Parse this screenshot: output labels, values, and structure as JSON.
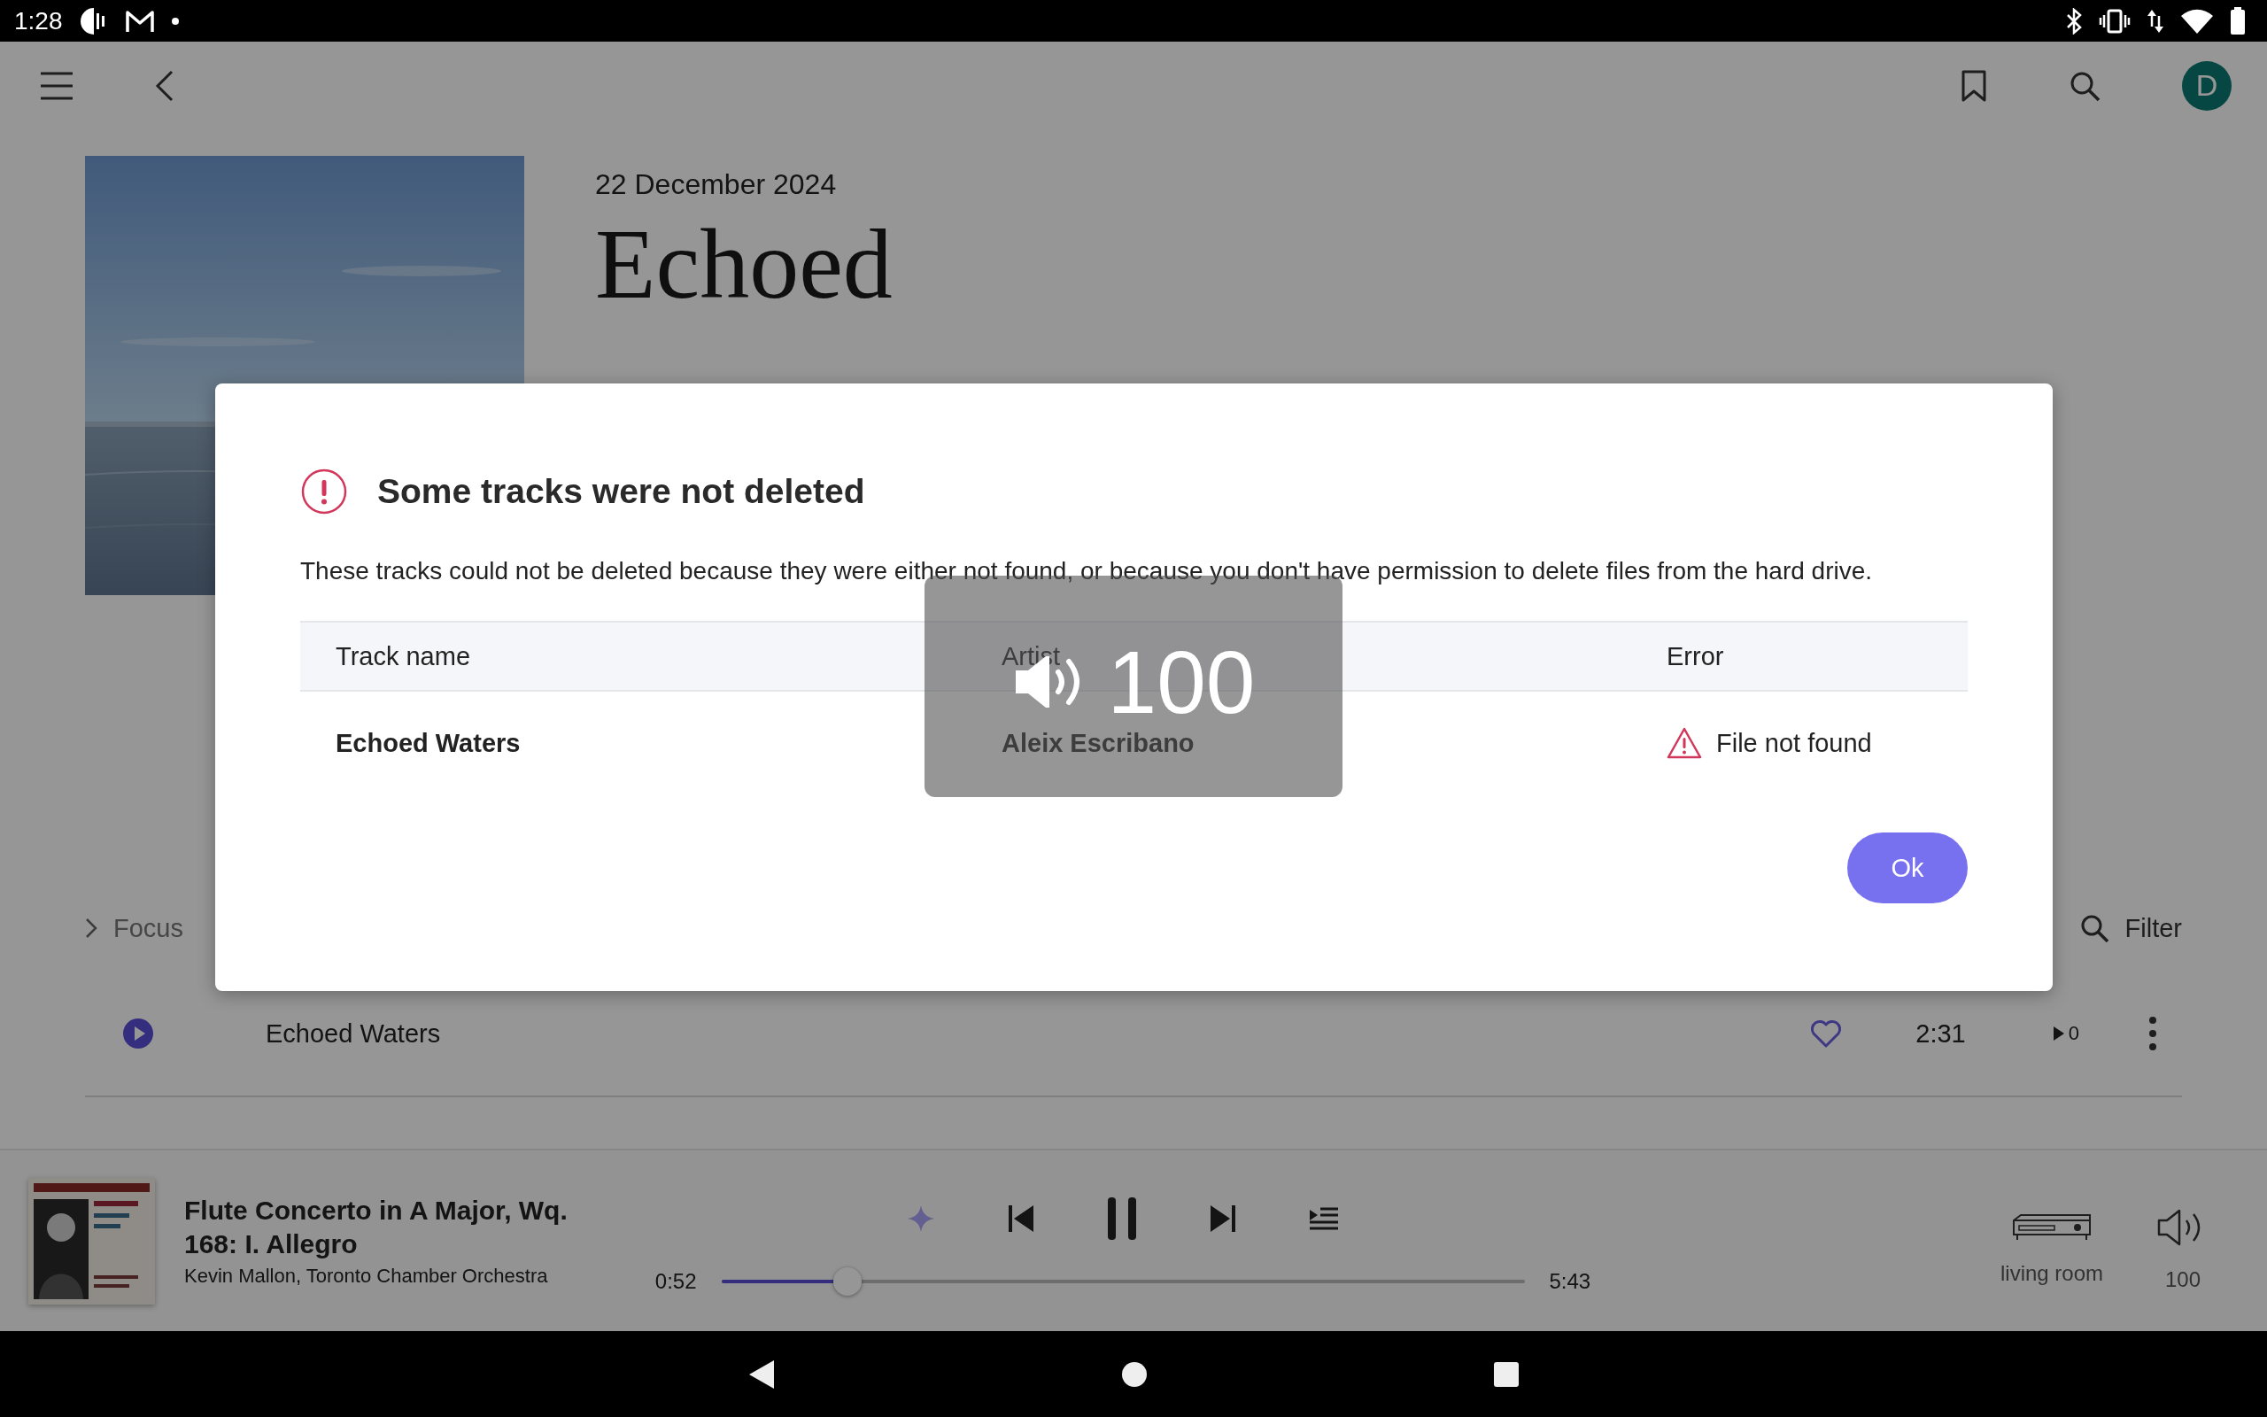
{
  "status_bar": {
    "time": "1:28"
  },
  "header": {
    "avatar_letter": "D"
  },
  "album": {
    "date": "22 December 2024",
    "title": "Echoed"
  },
  "filters": {
    "focus": "Focus",
    "filter": "Filter"
  },
  "tracks": [
    {
      "title": "Echoed Waters",
      "duration": "2:31",
      "plays": "0"
    }
  ],
  "now_playing": {
    "title": "Flute Concerto in A Major, Wq. 168: I. Allegro",
    "artist": "Kevin Mallon, Toronto Chamber Orchestra",
    "elapsed": "0:52",
    "total": "5:43",
    "level": 0.157,
    "playing": true,
    "device": "living room",
    "volume": "100"
  },
  "dialog": {
    "title": "Some tracks were not deleted",
    "message": "These tracks could not be deleted because they were either not found, or because you don't have permission to delete files from the hard drive.",
    "columns": [
      "Track name",
      "Artist",
      "Error"
    ],
    "rows": [
      {
        "track": "Echoed Waters",
        "artist": "Aleix Escribano",
        "error": "File not found"
      }
    ],
    "button": "Ok"
  },
  "volume_overlay": {
    "value": "100"
  }
}
